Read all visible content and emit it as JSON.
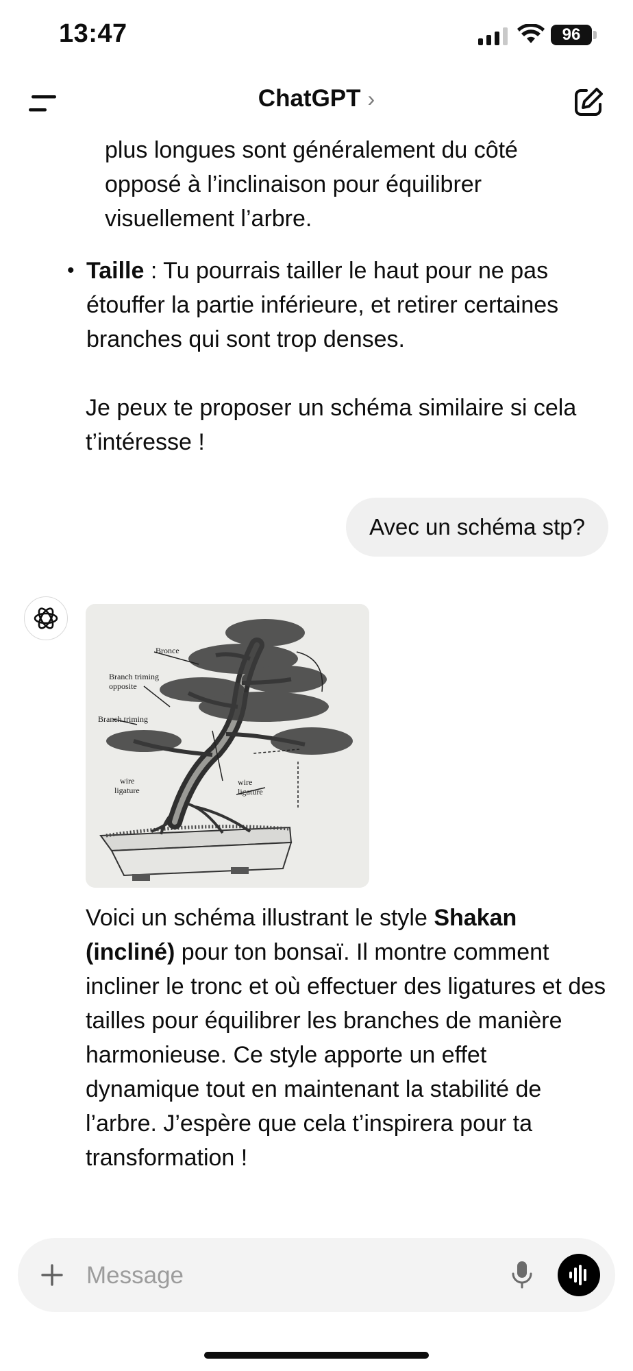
{
  "status_bar": {
    "time": "13:47",
    "battery": "96"
  },
  "header": {
    "title": "ChatGPT",
    "chevron": "›",
    "menu_icon": "menu-icon",
    "edit_icon": "new-chat-icon"
  },
  "conversation": {
    "partial_bullet": "plus longues sont généralement du côté opposé à l’inclinaison pour équilibrer visuellement l’arbre.",
    "bullet": {
      "bold": "Taille",
      "text": " : Tu pourrais tailler le haut pour ne pas étouffer la partie inférieure, et retirer certaines branches qui sont trop denses."
    },
    "paragraph1": "Je peux te proposer un schéma similaire si cela t’intéresse !",
    "user_message": "Avec un schéma stp?",
    "image_labels": {
      "label1": "Bronce",
      "label2a": "Branch triming",
      "label2b": "opposite",
      "label3": "Branch triming",
      "label4a": "wire",
      "label4b": "ligature",
      "label5a": "wire",
      "label5b": "ligature"
    },
    "response": {
      "part1": "Voici un schéma illustrant le style ",
      "bold": "Shakan (incliné)",
      "part2": " pour ton bonsaï. Il montre comment incliner le tronc et où effectuer des ligatures et des tailles pour équilibrer les branches de manière harmonieuse. Ce style apporte un effet dynamique tout en maintenant la stabilité de l’arbre. J’espère que cela t’inspirera pour ta transformation !"
    }
  },
  "composer": {
    "placeholder": "Message"
  }
}
